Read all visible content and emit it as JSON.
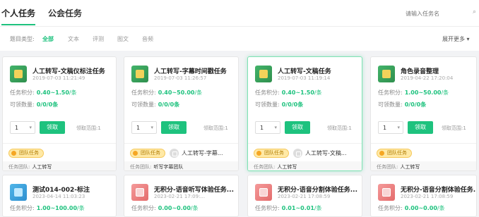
{
  "tabs": {
    "personal": "个人任务",
    "public": "公会任务"
  },
  "search": {
    "placeholder": "请输入任务名"
  },
  "filter": {
    "label": "题目类型:",
    "options": [
      "全部",
      "文本",
      "评测",
      "图文",
      "音频"
    ],
    "expand": "展开更多"
  },
  "labels": {
    "points": "任务积分:",
    "claimable": "可领数量:",
    "claim_button": "领取",
    "team_badge": "团队任务",
    "team": "任务团队:"
  },
  "cards": [
    {
      "title": "人工转写-文稿仪标注任务",
      "date": "2019-07-03 11:21:49",
      "points": "0.40~1.50",
      "unit": "/条",
      "claimable": "0/0/0条",
      "select": "1",
      "range": "领取范围:1",
      "team": "人工转写",
      "thumb": "green"
    },
    {
      "title": "人工转写-字幕时间戳任务",
      "date": "2019-07-03 11:26:57",
      "points": "0.40~50.00",
      "unit": "/条",
      "claimable": "0/0/0条",
      "select": "1",
      "range": "领取范围:1",
      "linked": "人工转写-字幕...",
      "team": "听写字幕团队",
      "thumb": "green"
    },
    {
      "title": "人工转写-文稿任务",
      "date": "2019-07-03 11:19:14",
      "points": "0.40~1.50",
      "unit": "/条",
      "claimable": "0/0/0条",
      "select": "1",
      "range": "领取范围:1",
      "linked": "人工转写-文稿...",
      "team": "人工转写",
      "thumb": "green"
    },
    {
      "title": "角色录音整理",
      "date": "2019-04-22 17:20:04",
      "points": "1.00~50.00",
      "unit": "/条",
      "claimable": "0/0/0条",
      "select": "1",
      "range": "领取范围:1",
      "team": "人工转写",
      "thumb": "green"
    },
    {
      "title": "测试014-002-标注",
      "date": "2023-04-14 11:03:23",
      "points": "1.00~100.00",
      "unit": "/条",
      "thumb": "blue"
    },
    {
      "title": "无积分-语音听写体验任务...",
      "date": "2023-02-21 17:09:...",
      "points": "0.00~0.00",
      "unit": "/条",
      "thumb": "red"
    },
    {
      "title": "无积分-语音分割体验任务...",
      "date": "2023-02-21 17:08:59",
      "points": "0.01~0.01",
      "unit": "/条",
      "thumb": "red"
    },
    {
      "title": "无积分-语音分割体验任务...",
      "date": "2023-02-21 17:08:59",
      "points": "0.00~0.00",
      "unit": "/条",
      "thumb": "red"
    }
  ],
  "colors": {
    "accent": "#1ec27e",
    "badge": "#f5a623"
  }
}
